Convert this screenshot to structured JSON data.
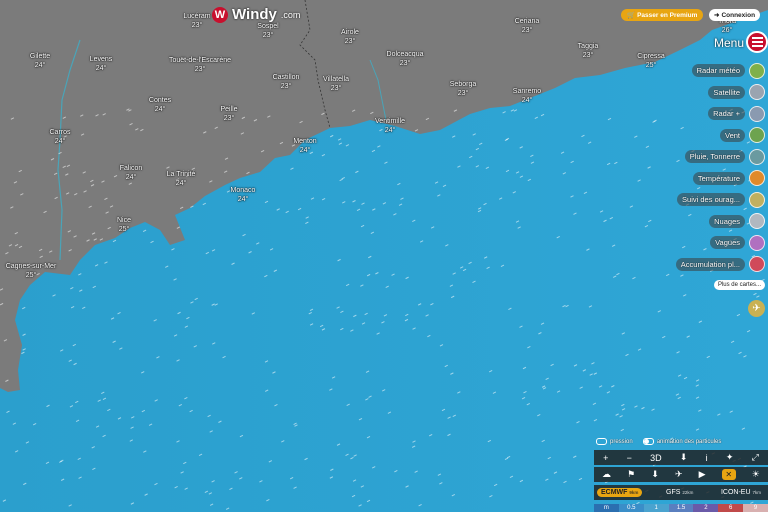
{
  "brand": {
    "name": "Windy",
    "domain": ".com",
    "mark": "W"
  },
  "header": {
    "premium_label": "Passer en Premium",
    "premium_icon": "cart-icon",
    "login_label": "Connexion",
    "login_icon": "login-arrow-icon"
  },
  "menu": {
    "label": "Menu",
    "icon": "hamburger-icon"
  },
  "layers": [
    {
      "label": "Radar météo",
      "icon": "radar-meteo-icon"
    },
    {
      "label": "Satellite",
      "icon": "satellite-icon"
    },
    {
      "label": "Radar +",
      "icon": "radar-plus-icon"
    },
    {
      "label": "Vent",
      "icon": "wind-icon"
    },
    {
      "label": "Pluie, Tonnerre",
      "icon": "rain-icon"
    },
    {
      "label": "Température",
      "icon": "temperature-icon"
    },
    {
      "label": "Suivi des ouragans",
      "display": "Suivi des ourag...",
      "icon": "hurricane-icon"
    },
    {
      "label": "Nuages",
      "icon": "clouds-icon"
    },
    {
      "label": "Vagues",
      "icon": "waves-icon"
    },
    {
      "label": "Accumulation pl...",
      "icon": "rain-accumulation-icon"
    }
  ],
  "more_label": "Plus de cartes...",
  "toggles": {
    "pressure": "pression",
    "particles": "animation des particules"
  },
  "toolbar1": [
    "+",
    "−",
    "3D",
    "⬇",
    "i",
    "✦",
    "⤢"
  ],
  "toolbar2": [
    "☁",
    "⚑",
    "⬇",
    "✈",
    "▶",
    "✕",
    "☀"
  ],
  "models": [
    {
      "name": "ECMWF",
      "res": "9km",
      "selected": true
    },
    {
      "name": "GFS",
      "res": "22km",
      "selected": false
    },
    {
      "name": "ICON-EU",
      "res": "7km",
      "selected": false
    }
  ],
  "legend": {
    "unit": "m",
    "values": [
      "0.5",
      "1",
      "1.5",
      "2",
      "6",
      "9"
    ]
  },
  "cities": [
    {
      "name": "Lucéram",
      "temp": "23°"
    },
    {
      "name": "Sospel",
      "temp": "23°"
    },
    {
      "name": "Airole",
      "temp": "23°"
    },
    {
      "name": "Ceriana",
      "temp": "23°"
    },
    {
      "name": "Triora",
      "temp": "26°"
    },
    {
      "name": "Gilette",
      "temp": "24°"
    },
    {
      "name": "Levens",
      "temp": "24°"
    },
    {
      "name": "Touët-de-l'Escarène",
      "temp": "23°"
    },
    {
      "name": "Dolceacqua",
      "temp": "23°"
    },
    {
      "name": "Taggia",
      "temp": "23°"
    },
    {
      "name": "Cipressa",
      "temp": "25°"
    },
    {
      "name": "Castillon",
      "temp": "23°"
    },
    {
      "name": "Villatella",
      "temp": "23°"
    },
    {
      "name": "Seborga",
      "temp": "23°"
    },
    {
      "name": "Sanremo",
      "temp": "24°"
    },
    {
      "name": "Contes",
      "temp": "24°"
    },
    {
      "name": "Peille",
      "temp": "23°"
    },
    {
      "name": "Ventimille",
      "temp": "24°"
    },
    {
      "name": "Carros",
      "temp": "24°"
    },
    {
      "name": "Menton",
      "temp": "24°"
    },
    {
      "name": "Falicon",
      "temp": "24°"
    },
    {
      "name": "La Trinité",
      "temp": "24°"
    },
    {
      "name": "Monaco",
      "temp": "24°"
    },
    {
      "name": "Nice",
      "temp": "25°"
    },
    {
      "name": "Cagnes-sur-Mer",
      "temp": "25°"
    }
  ]
}
